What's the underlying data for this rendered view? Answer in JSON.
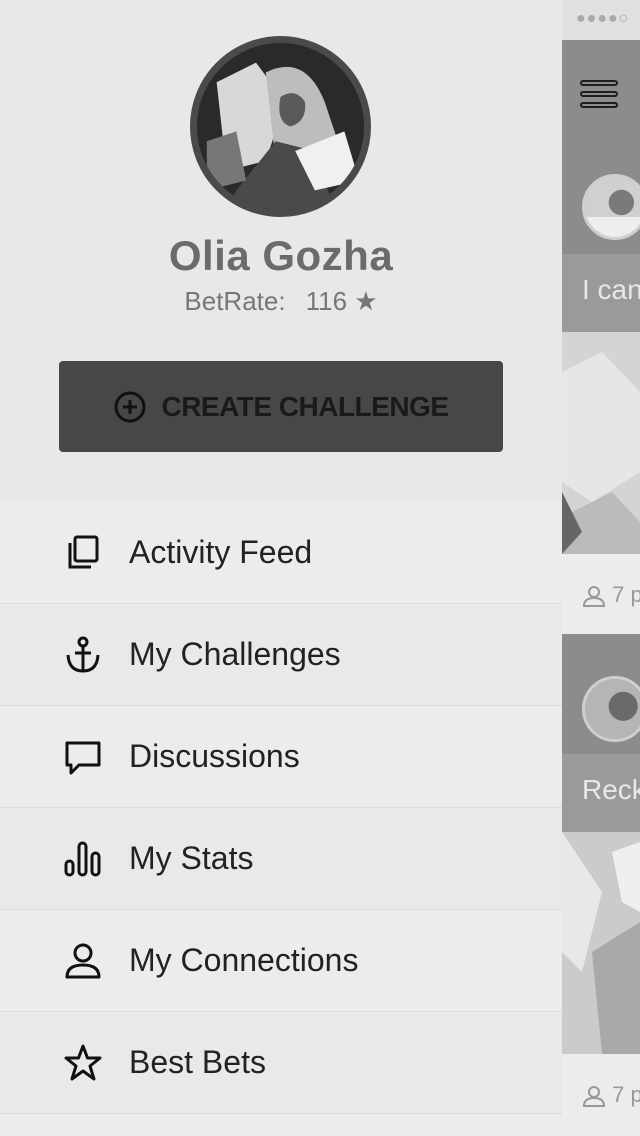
{
  "profile": {
    "name": "Olia Gozha",
    "betrate_label": "BetRate:",
    "betrate_value": "116",
    "star": "★"
  },
  "create_button": {
    "label": "CREATE CHALLENGE",
    "icon": "plus-circle-icon"
  },
  "menu": {
    "items": [
      {
        "label": "Activity Feed",
        "icon": "copy-pages-icon"
      },
      {
        "label": "My Challenges",
        "icon": "anchor-icon"
      },
      {
        "label": "Discussions",
        "icon": "speech-bubble-icon"
      },
      {
        "label": "My Stats",
        "icon": "bar-stats-icon"
      },
      {
        "label": "My Connections",
        "icon": "person-icon"
      },
      {
        "label": "Best Bets",
        "icon": "star-icon"
      }
    ]
  },
  "peek": {
    "status_dots": "●●●●○",
    "card1_caption": "I can",
    "card1_meta": "7 p",
    "card2_caption": "Reck",
    "card2_meta": "7 p"
  },
  "colors": {
    "drawer_bg": "#ebebeb",
    "button_bg": "#474747",
    "name_text": "#6b6b6b",
    "menu_text": "#222222"
  }
}
